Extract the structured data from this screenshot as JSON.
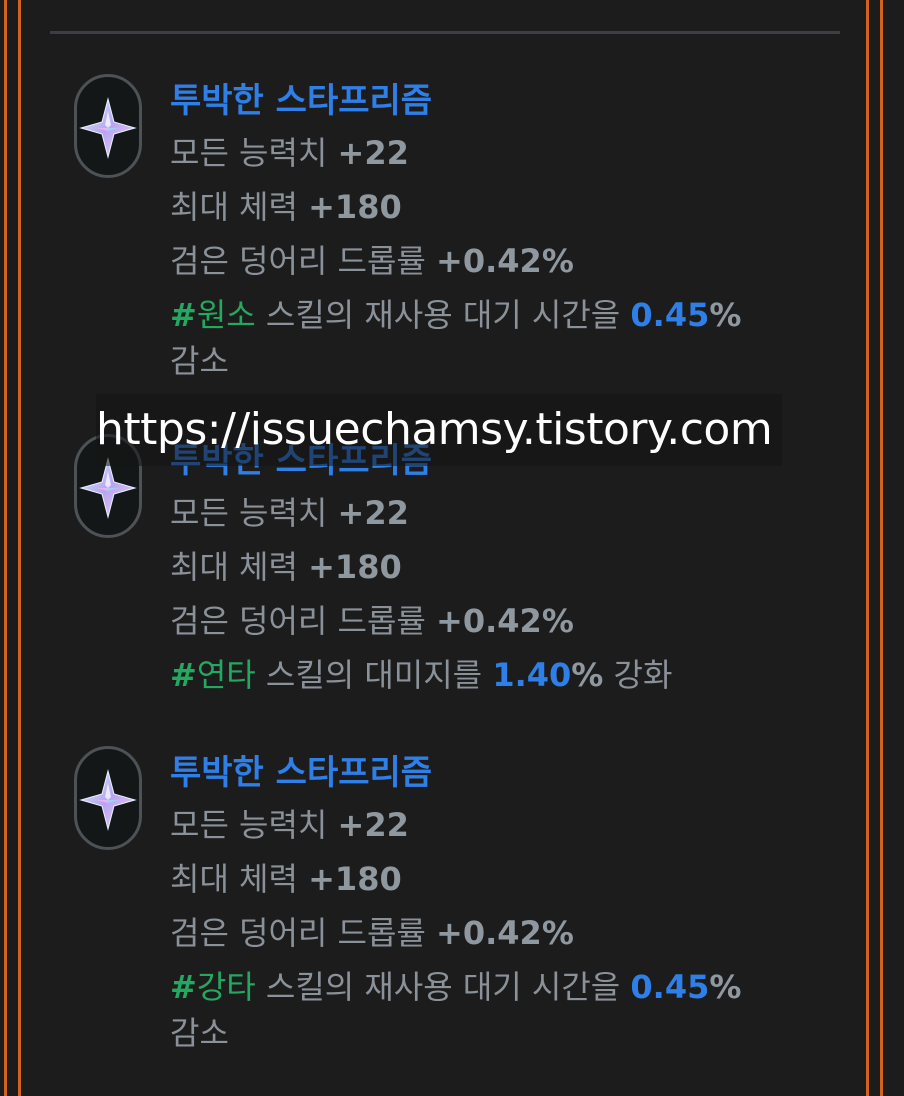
{
  "cards": [
    {
      "title": "투박한 스타프리즘",
      "stat1_label": "모든 능력치",
      "stat1_value": "+22",
      "stat2_label": "최대 체력",
      "stat2_value": "+180",
      "stat3_label": "검은 덩어리 드롭률",
      "stat3_value": "+0.42%",
      "skill_hash": "#",
      "skill_tag": "원소",
      "skill_text_before": " 스킬의 재사용 대기 시간을 ",
      "skill_pct": "0.45",
      "skill_pct_sign": "%",
      "skill_text_after": "감소"
    },
    {
      "title": "투박한 스타프리즘",
      "stat1_label": "모든 능력치",
      "stat1_value": "+22",
      "stat2_label": "최대 체력",
      "stat2_value": "+180",
      "stat3_label": "검은 덩어리 드롭률",
      "stat3_value": "+0.42%",
      "skill_hash": "#",
      "skill_tag": "연타",
      "skill_text_before": " 스킬의 대미지를 ",
      "skill_pct": "1.40",
      "skill_pct_sign": "%",
      "skill_text_after": " 강화"
    },
    {
      "title": "투박한 스타프리즘",
      "stat1_label": "모든 능력치",
      "stat1_value": "+22",
      "stat2_label": "최대 체력",
      "stat2_value": "+180",
      "stat3_label": "검은 덩어리 드롭률",
      "stat3_value": "+0.42%",
      "skill_hash": "#",
      "skill_tag": "강타",
      "skill_text_before": " 스킬의 재사용 대기 시간을 ",
      "skill_pct": "0.45",
      "skill_pct_sign": "%",
      "skill_text_after": "감소"
    }
  ],
  "watermark": "https://issuechamsy.tistory.com",
  "colors": {
    "accent_blue": "#2f7fe8",
    "tag_green": "#23a85f",
    "border_orange": "#d4621f",
    "text_gray": "#8a9199"
  },
  "icons": {
    "gem": "star-prism-gem-icon"
  }
}
